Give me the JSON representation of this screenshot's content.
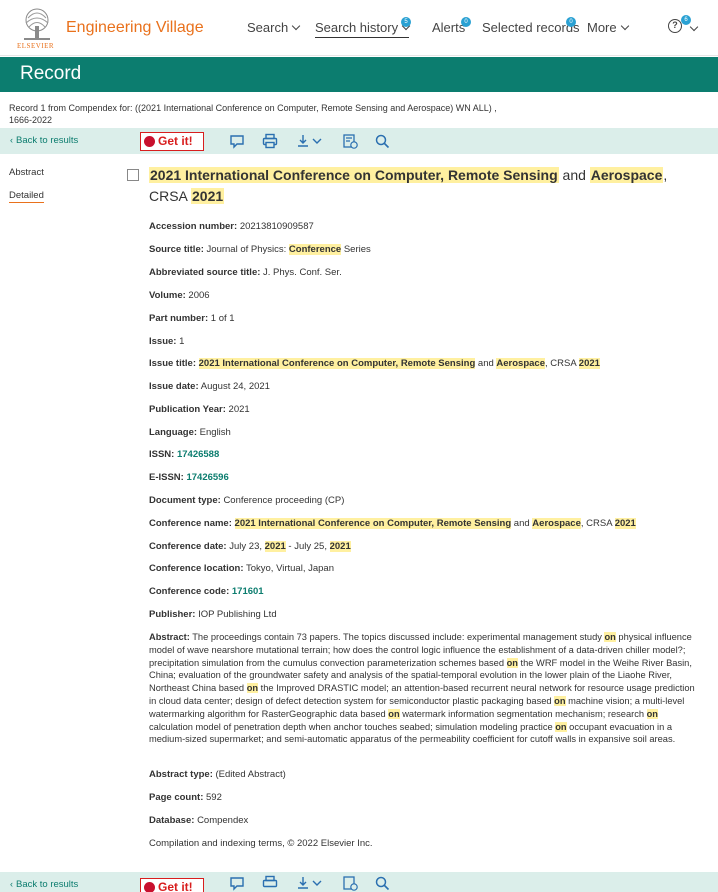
{
  "header": {
    "logo_word": "ELSEVIER",
    "brand": "Engineering Village",
    "nav": [
      {
        "label": "Search",
        "badge": ""
      },
      {
        "label": "Search history",
        "badge": "5"
      },
      {
        "label": "Alerts",
        "badge": "0"
      },
      {
        "label": "Selected records",
        "badge": "0"
      },
      {
        "label": "More",
        "badge": ""
      }
    ],
    "help_badge": "6",
    "help_glyph": "?"
  },
  "page_title": "Record",
  "record_info": "Record 1 from Compendex for: ((2021 International Conference on Computer, Remote Sensing and Aerospace) WN ALL) , 1666-2022",
  "actions": {
    "back_label": "Back to results",
    "getit_label": "Get it!"
  },
  "sidenav": [
    "Abstract",
    "Detailed"
  ],
  "record": {
    "title_parts": [
      {
        "text": "2021 International Conference on Computer, Remote Sensing",
        "hl": true
      },
      {
        "text": " and ",
        "hl": false
      },
      {
        "text": "Aerospace",
        "hl": true
      },
      {
        "text": ", CRSA ",
        "hl": false
      },
      {
        "text": "2021",
        "hl": true
      }
    ],
    "fields": {
      "accession": {
        "label": "Accession number:",
        "value": "20213810909587"
      },
      "source_title": {
        "label": "Source title:",
        "pre": "Journal of Physics: ",
        "hl": "Conference",
        "post": " Series"
      },
      "abbrev": {
        "label": "Abbreviated source title:",
        "value": "J. Phys. Conf. Ser."
      },
      "volume": {
        "label": "Volume:",
        "value": "2006"
      },
      "part": {
        "label": "Part number:",
        "value": "1 of 1"
      },
      "issue": {
        "label": "Issue:",
        "value": "1"
      },
      "issue_title": {
        "label": "Issue title:",
        "hl1": "2021 International Conference on Computer, Remote Sensing",
        "mid": " and ",
        "hl2": "Aerospace",
        "mid2": ", CRSA ",
        "hl3": "2021"
      },
      "issue_date": {
        "label": "Issue date:",
        "value": "August 24, 2021"
      },
      "pub_year": {
        "label": "Publication Year:",
        "value": "2021"
      },
      "language": {
        "label": "Language:",
        "value": "English"
      },
      "issn": {
        "label": "ISSN:",
        "value": "17426588"
      },
      "eissn": {
        "label": "E-ISSN:",
        "value": "17426596"
      },
      "doctype": {
        "label": "Document type:",
        "value": "Conference proceeding (CP)"
      },
      "conf_name": {
        "label": "Conference name:",
        "hl1": "2021 International Conference on Computer, Remote Sensing",
        "mid": " and ",
        "hl2": "Aerospace",
        "mid2": ", CRSA ",
        "hl3": "2021"
      },
      "conf_date": {
        "label": "Conference date:",
        "pre": "July 23, ",
        "hl1": "2021",
        "mid": " - July 25, ",
        "hl2": "2021"
      },
      "conf_loc": {
        "label": "Conference location:",
        "value": "Tokyo, Virtual, Japan"
      },
      "conf_code": {
        "label": "Conference code:",
        "value": "171601"
      },
      "publisher": {
        "label": "Publisher:",
        "value": "IOP Publishing Ltd"
      },
      "abstract_label": "Abstract:",
      "abstract_parts": [
        {
          "text": "The proceedings contain 73 papers. The topics discussed include: experimental management study ",
          "hl": false
        },
        {
          "text": "on",
          "hl": true
        },
        {
          "text": " physical influence model of wave nearshore mutational terrain; how does the control logic influence the establishment of a data-driven chiller model?; precipitation simulation from the cumulus convection parameterization schemes based ",
          "hl": false
        },
        {
          "text": "on",
          "hl": true
        },
        {
          "text": " the WRF model in the Weihe River Basin, China; evaluation of the groundwater safety and analysis of the spatial-temporal evolution in the lower plain of the Liaohe River, Northeast China based ",
          "hl": false
        },
        {
          "text": "on",
          "hl": true
        },
        {
          "text": " the Improved DRASTIC model; an attention-based recurrent neural network for resource usage prediction in cloud data center; design of defect detection system for semiconductor plastic packaging based ",
          "hl": false
        },
        {
          "text": "on",
          "hl": true
        },
        {
          "text": " machine vision; a multi-level watermarking algorithm for RasterGeographic data based ",
          "hl": false
        },
        {
          "text": "on",
          "hl": true
        },
        {
          "text": " watermark information segmentation mechanism; research ",
          "hl": false
        },
        {
          "text": "on",
          "hl": true
        },
        {
          "text": " calculation model of penetration depth when anchor touches seabed; simulation modeling practice ",
          "hl": false
        },
        {
          "text": "on",
          "hl": true
        },
        {
          "text": " occupant evacuation in a medium-sized supermarket; and semi-automatic apparatus of the permeability coefficient for cutoff walls in expansive soil areas.",
          "hl": false
        }
      ],
      "abstract_type": {
        "label": "Abstract type:",
        "value": "(Edited Abstract)"
      },
      "page_count": {
        "label": "Page count:",
        "value": "592"
      },
      "database": {
        "label": "Database:",
        "value": "Compendex"
      },
      "copyright": "Compilation and indexing terms, © 2022 Elsevier Inc."
    }
  },
  "colors": {
    "brand_orange": "#e9711c",
    "header_green": "#0c7d6f",
    "highlight": "#fff0a0",
    "action_bg": "#dbeeea",
    "badge_blue": "#2aa1d3"
  }
}
